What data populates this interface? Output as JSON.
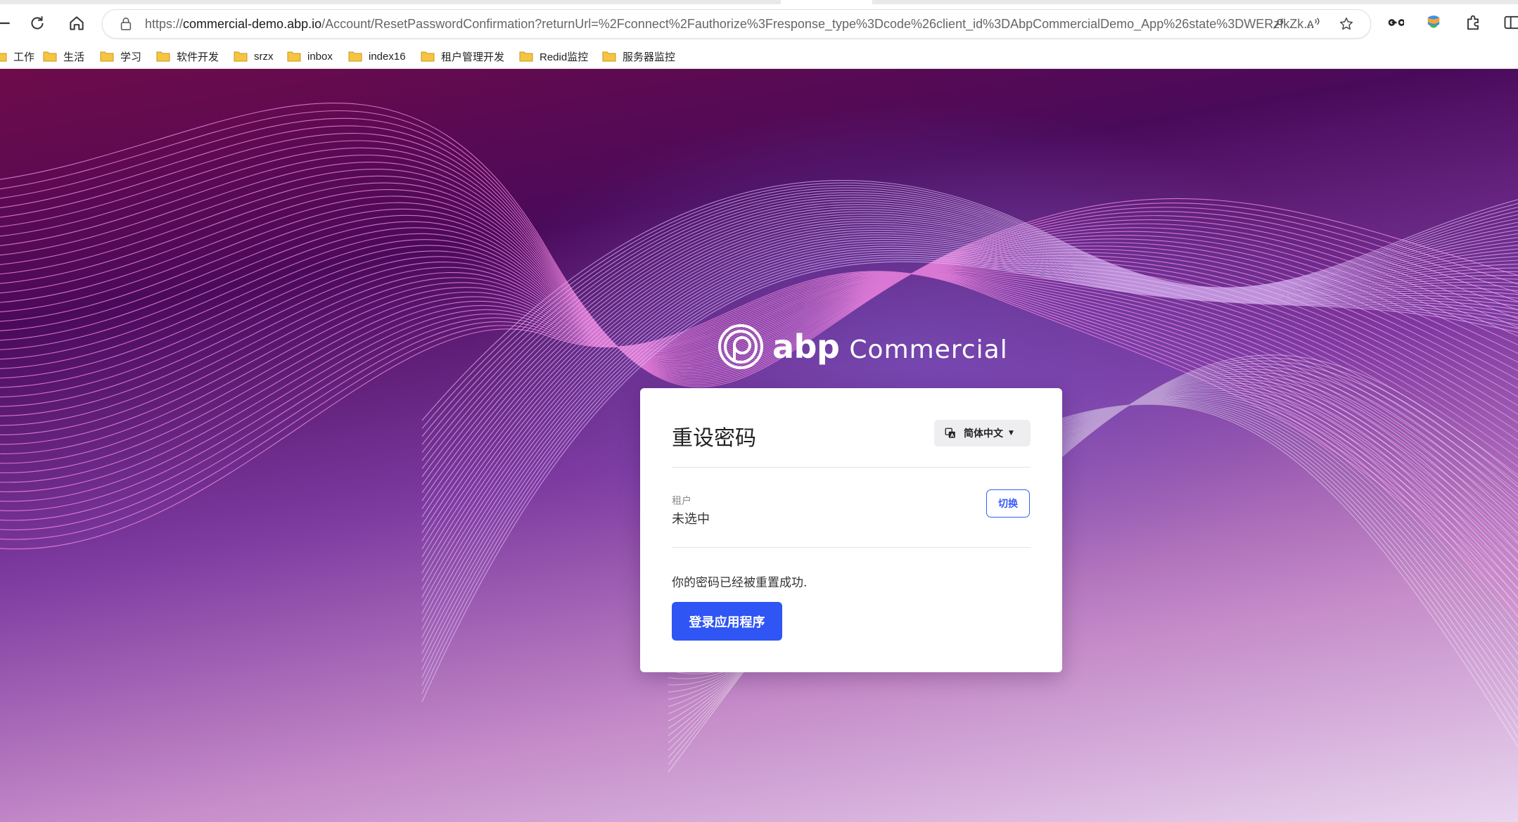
{
  "browser": {
    "url_prefix": "https://",
    "url_host": "commercial-demo.abp.io",
    "url_rest": "/Account/ResetPasswordConfirmation?returnUrl=%2Fconnect%2Fauthorize%3Fresponse_type%3Dcode%26client_id%3DAbpCommercialDemo_App%26state%3DWERzfkZk...",
    "icons": [
      "back-icon",
      "refresh-icon",
      "home-icon",
      "lock-icon",
      "key-icon",
      "read-aloud-icon",
      "favorite-star-icon",
      "infinity-icon",
      "copilot-icon",
      "extensions-icon",
      "split-screen-icon"
    ]
  },
  "bookmarks": [
    {
      "label": "工作"
    },
    {
      "label": "生活"
    },
    {
      "label": "学习"
    },
    {
      "label": "软件开发"
    },
    {
      "label": "srzx"
    },
    {
      "label": "inbox"
    },
    {
      "label": "index16"
    },
    {
      "label": "租户管理开发"
    },
    {
      "label": "Redid监控"
    },
    {
      "label": "服务器监控"
    }
  ],
  "logo": {
    "abp": "abp",
    "commercial": "Commercial"
  },
  "card": {
    "title": "重设密码",
    "language": "简体中文",
    "tenant_label": "租户",
    "tenant_value": "未选中",
    "switch_label": "切换",
    "message": "你的密码已经被重置成功.",
    "login_label": "登录应用程序"
  },
  "colors": {
    "primary": "#2f55f4",
    "background_top": "#6e0b4a",
    "background_bottom": "#e9d6ef"
  }
}
